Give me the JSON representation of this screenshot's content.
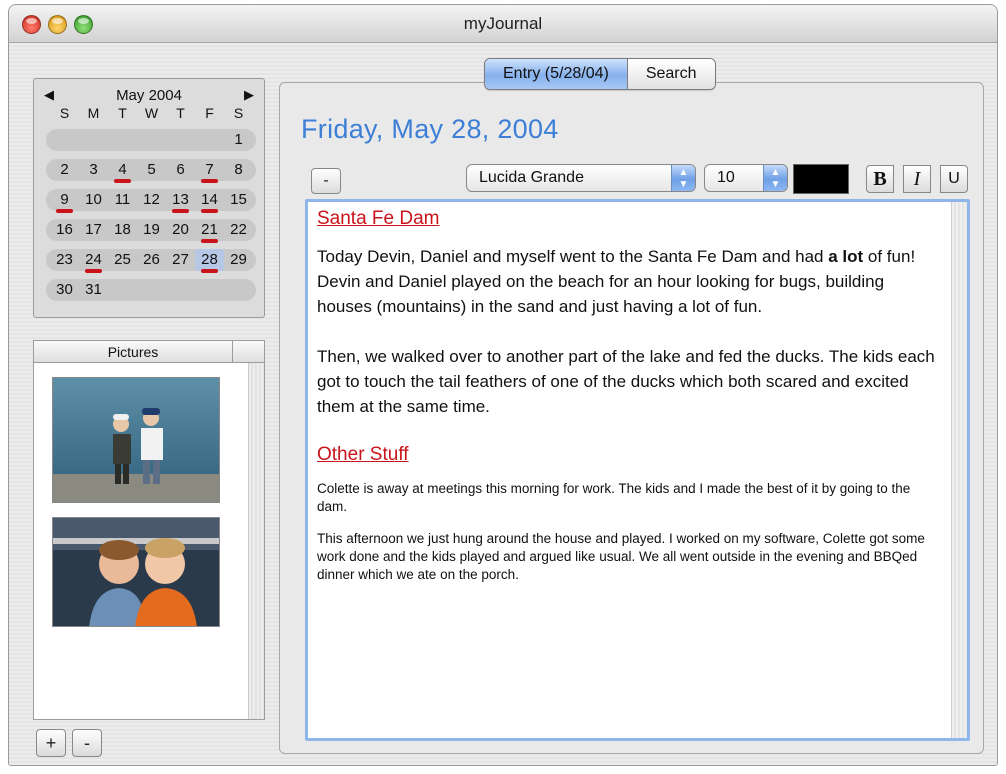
{
  "window": {
    "title": "myJournal"
  },
  "calendar": {
    "month_label": "May 2004",
    "prev_label": "◀",
    "next_label": "▶",
    "weekdays": [
      "S",
      "M",
      "T",
      "W",
      "T",
      "F",
      "S"
    ],
    "weeks": [
      [
        "",
        "",
        "",
        "",
        "",
        "",
        "1"
      ],
      [
        "2",
        "3",
        "4",
        "5",
        "6",
        "7",
        "8"
      ],
      [
        "9",
        "10",
        "11",
        "12",
        "13",
        "14",
        "15"
      ],
      [
        "16",
        "17",
        "18",
        "19",
        "20",
        "21",
        "22"
      ],
      [
        "23",
        "24",
        "25",
        "26",
        "27",
        "28",
        "29"
      ],
      [
        "30",
        "31",
        "",
        "",
        "",
        "",
        ""
      ]
    ],
    "entry_days": [
      "4",
      "7",
      "9",
      "13",
      "14",
      "21",
      "24",
      "28"
    ],
    "selected_day": "28"
  },
  "pictures": {
    "header": "Pictures",
    "add_label": "+",
    "remove_label": "-"
  },
  "tabs": {
    "entry_label": "Entry (5/28/04)",
    "search_label": "Search"
  },
  "entry": {
    "date_title": "Friday, May 28, 2004",
    "toolbar": {
      "minus_label": "-",
      "font_name": "Lucida Grande",
      "font_size": "10",
      "text_color": "#000000",
      "bold_label": "B",
      "italic_label": "I",
      "underline_label": "U"
    },
    "sections": [
      {
        "heading": "Santa Fe Dam",
        "paragraphs": [
          "Today Devin, Daniel and myself went to the Santa Fe Dam and had a lot of fun! Devin and Daniel played on the beach for an hour looking for bugs, building houses (mountains) in the sand and just having a lot of fun.",
          "Then, we walked over to another part of the lake and fed the ducks. The kids each got to touch the tail feathers of one of the ducks which both scared and excited them at the same time."
        ]
      },
      {
        "heading": "Other Stuff",
        "paragraphs": [
          "Colette is away at meetings this morning for work. The kids and I made the best of it by going to the dam.",
          "This afternoon we just hung around the house and played. I worked on my software, Colette got some work done and the kids played and argued like usual. We all went outside in the evening and BBQed dinner which we ate on the porch."
        ]
      }
    ]
  },
  "colors": {
    "accent": "#3d7fd6",
    "heading_red": "#c8141a",
    "focus_ring": "#8fb6ea"
  }
}
